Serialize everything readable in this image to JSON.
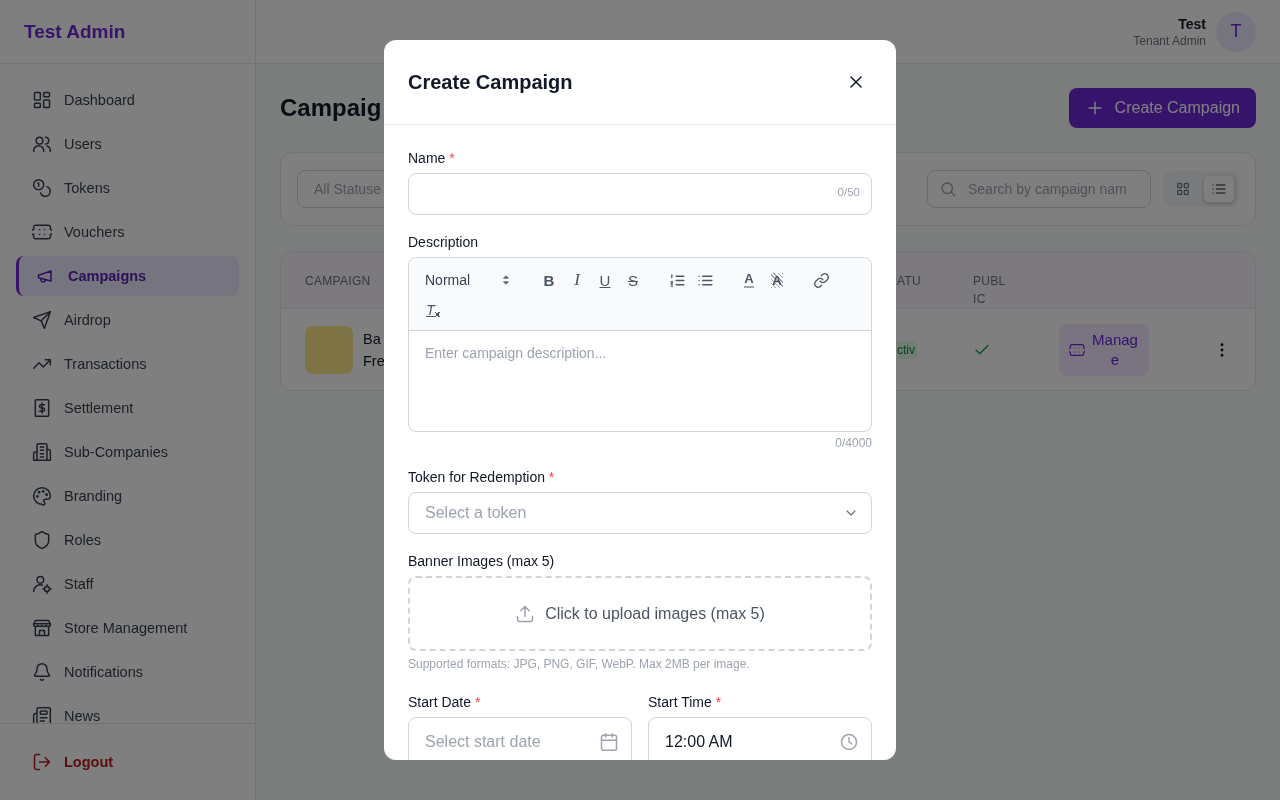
{
  "sidebar": {
    "brand": "Test Admin",
    "items": [
      {
        "label": "Dashboard",
        "selected": false
      },
      {
        "label": "Users",
        "selected": false
      },
      {
        "label": "Tokens",
        "selected": false
      },
      {
        "label": "Vouchers",
        "selected": false
      },
      {
        "label": "Campaigns",
        "selected": true
      },
      {
        "label": "Airdrop",
        "selected": false
      },
      {
        "label": "Transactions",
        "selected": false
      },
      {
        "label": "Settlement",
        "selected": false
      },
      {
        "label": "Sub-Companies",
        "selected": false
      },
      {
        "label": "Branding",
        "selected": false
      },
      {
        "label": "Roles",
        "selected": false
      },
      {
        "label": "Staff",
        "selected": false
      },
      {
        "label": "Store Management",
        "selected": false
      },
      {
        "label": "Notifications",
        "selected": false
      },
      {
        "label": "News",
        "selected": false
      }
    ],
    "logout": "Logout"
  },
  "header": {
    "user_name": "Test",
    "user_role": "Tenant Admin",
    "avatar": "T"
  },
  "page": {
    "title": "Campaig",
    "create_button": "Create Campaign"
  },
  "filters": {
    "status_select": "All Statuse",
    "search": {
      "placeholder": "Search by campaign nam"
    },
    "views": [
      {
        "kind": "grid",
        "selected": false
      },
      {
        "kind": "list",
        "selected": true
      }
    ]
  },
  "table": {
    "columns": [
      "CAMPAIGN",
      "ATU",
      "PUBLIC"
    ],
    "rows": [
      {
        "name": "Ba Fre",
        "status": "ctiv",
        "public": true,
        "action": "Manage"
      }
    ]
  },
  "modal": {
    "title": "Create Campaign",
    "name_field": {
      "label": "Name",
      "required_mark": "*",
      "counter": "0/50"
    },
    "description": {
      "label": "Description",
      "toolbar": [
        [
          {
            "kind": "select",
            "label": "Normal"
          }
        ],
        [
          {
            "kind": "bold",
            "label": "B"
          },
          {
            "kind": "italic",
            "label": "I"
          },
          {
            "kind": "underline",
            "label": "U"
          },
          {
            "kind": "strike",
            "label": "S"
          }
        ],
        [
          {
            "kind": "ordered-list"
          },
          {
            "kind": "bullet-list"
          }
        ],
        [
          {
            "kind": "color",
            "label": "A"
          },
          {
            "kind": "background",
            "label": "A"
          }
        ],
        [
          {
            "kind": "link"
          }
        ],
        [
          {
            "kind": "clean",
            "label": "T"
          }
        ]
      ],
      "placeholder": "Enter campaign description...",
      "counter": "0/4000"
    },
    "token_field": {
      "label": "Token for Redemption",
      "required_mark": "*",
      "placeholder": "Select a token"
    },
    "banner": {
      "label": "Banner Images (max 5)",
      "upload_text": "Click to upload images (max 5)",
      "hint": "Supported formats: JPG, PNG, GIF, WebP. Max 2MB per image."
    },
    "start_date": {
      "label": "Start Date",
      "required_mark": "*",
      "placeholder": "Select start date"
    },
    "start_time": {
      "label": "Start Time",
      "required_mark": "*",
      "value": "12:00 AM"
    }
  }
}
